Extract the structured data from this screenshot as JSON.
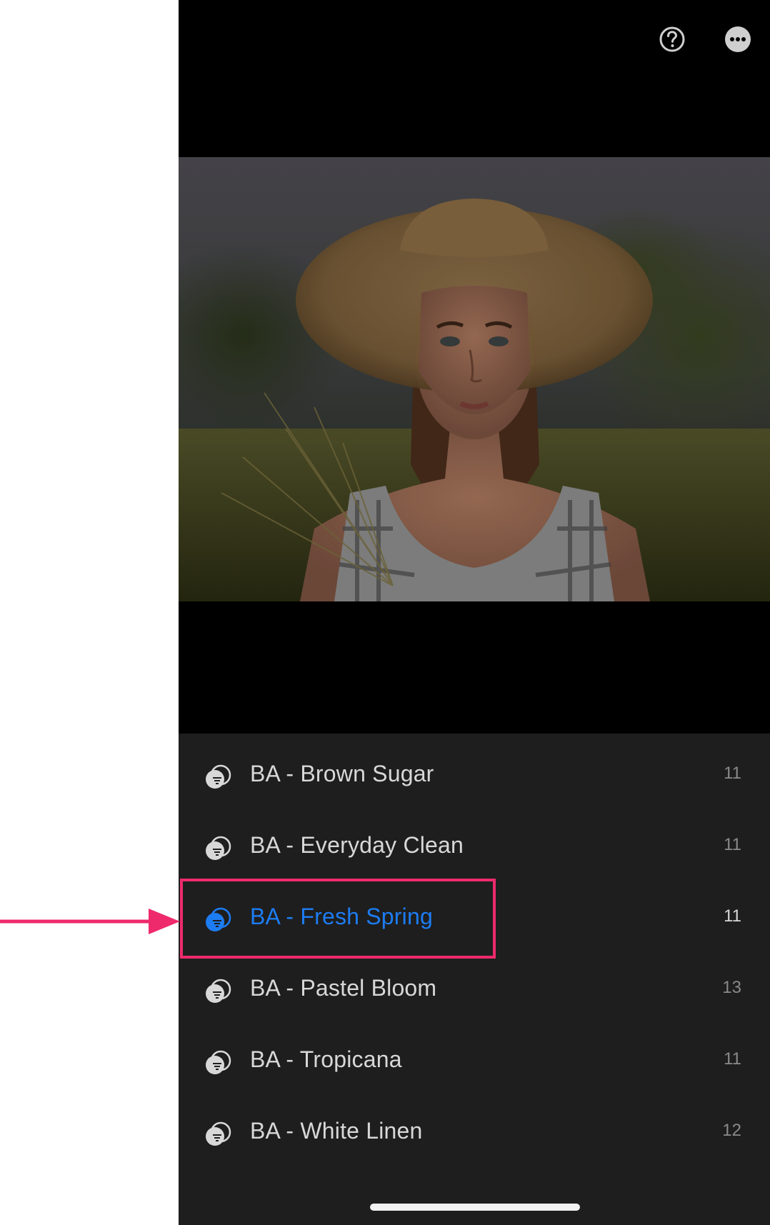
{
  "toolbar": {
    "help_icon": "help-circle-icon",
    "more_icon": "more-ellipsis-icon"
  },
  "photo": {
    "subject": "photo-preview"
  },
  "presets": [
    {
      "label": "BA - Brown Sugar",
      "count": "11",
      "selected": false
    },
    {
      "label": "BA - Everyday Clean",
      "count": "11",
      "selected": false
    },
    {
      "label": "BA - Fresh Spring",
      "count": "11",
      "selected": true
    },
    {
      "label": "BA - Pastel Bloom",
      "count": "13",
      "selected": false
    },
    {
      "label": "BA - Tropicana",
      "count": "11",
      "selected": false
    },
    {
      "label": "BA - White Linen",
      "count": "12",
      "selected": false
    }
  ],
  "colors": {
    "selected_accent": "#1d7cf2",
    "annotation": "#ee2a6d",
    "panel_bg": "#1e1e1e",
    "label_text": "#d8d8d8",
    "count_text": "#8a8a8a"
  }
}
